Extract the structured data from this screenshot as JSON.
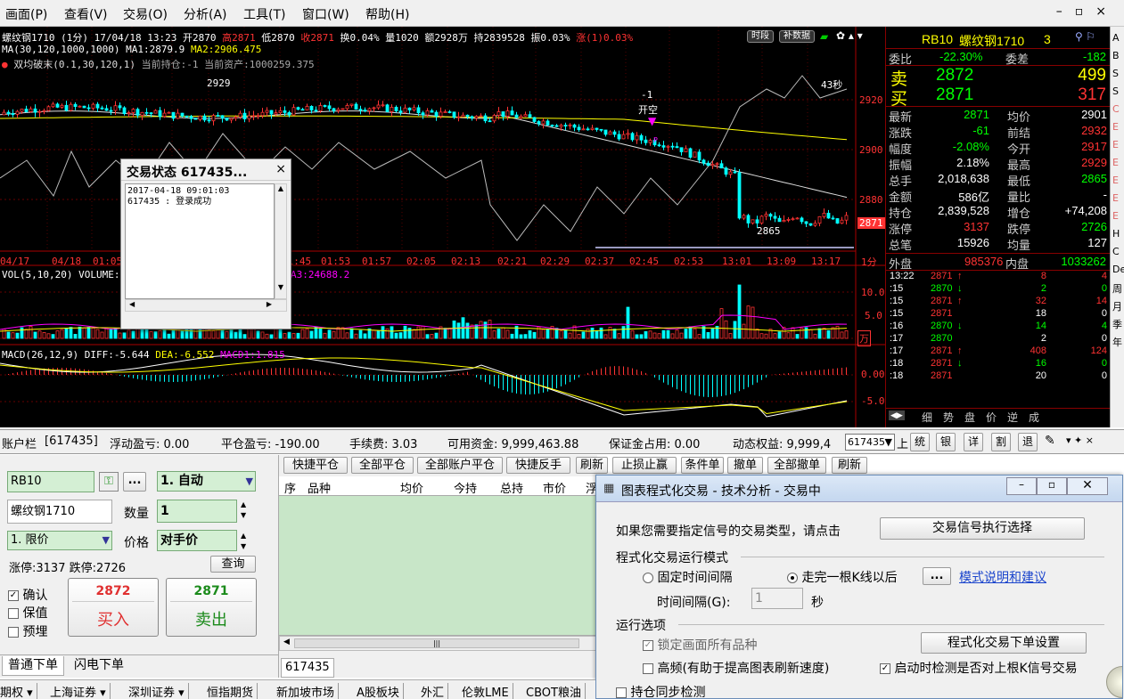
{
  "menu": {
    "items": [
      "画面(P)",
      "查看(V)",
      "交易(O)",
      "分析(A)",
      "工具(T)",
      "窗口(W)",
      "帮助(H)"
    ]
  },
  "chart_header": {
    "line1_instrument": "螺纹钢1710 (1分) 17/04/18 13:23",
    "open": "开2870",
    "high": "高2871",
    "low": "低2870",
    "close": "收2871",
    "turnover": "换0.04%",
    "volume": "量1020",
    "amount": "额2928万",
    "position": "持2839528",
    "amplitude": "振0.03%",
    "change": "涨(1)0.03%",
    "ma_line": "MA(30,120,1000,1000)",
    "ma1": "MA1:2879.9",
    "ma2": "MA2:2906.475",
    "strategy": "双均破末(0.1,30,120,1)",
    "holding": "当前持仓:-1",
    "assets": "当前资产:1000259.375",
    "btn_time": "时段",
    "btn_fill": "补数据"
  },
  "chart_labels": {
    "high_label": "2929",
    "low_label": "2865",
    "signal_num": "-1",
    "signal_text": "开空",
    "timer": "43秒",
    "cur_price": "2871",
    "y_ticks": [
      "2920",
      "2900",
      "2880"
    ],
    "x_ticks": [
      "04/17",
      "04/18",
      "01:05",
      "01:13",
      "01:21",
      "01:29",
      "01:37",
      "01:45",
      "01:53",
      "01:57",
      "02:05",
      "02:13",
      "02:21",
      "02:29",
      "02:37",
      "02:45",
      "02:53",
      "13:01",
      "13:09",
      "13:17"
    ],
    "period": "1分",
    "vol_title": "VOL(5,10,20) VOLUME:1",
    "vol_ma3": "A3:24688.2",
    "vol_ticks": [
      "10.0",
      "5.0"
    ],
    "vol_unit": "万",
    "macd_title": "MACD(26,12,9)",
    "diff": "DIFF:-5.644",
    "dea": "DEA:-6.552",
    "macd": "MACD1:1.815",
    "macd_ticks": [
      "0.00",
      "-5.00"
    ]
  },
  "popup": {
    "title": "交易状态 617435...",
    "time": "2017-04-18 09:01:03",
    "msg": "617435 : 登录成功"
  },
  "quote": {
    "code": "RB10",
    "name": "螺纹钢1710",
    "num": "3",
    "weibi_label": "委比",
    "weibi": "-22.30%",
    "weicha_label": "委差",
    "weicha": "-182",
    "sell_label": "卖",
    "sell_price": "2872",
    "sell_vol": "499",
    "buy_label": "买",
    "buy_price": "2871",
    "buy_vol": "317",
    "rows": [
      [
        "最新",
        "2871",
        "均价",
        "2901"
      ],
      [
        "涨跌",
        "-61",
        "前结",
        "2932"
      ],
      [
        "幅度",
        "-2.08%",
        "今开",
        "2917"
      ],
      [
        "振幅",
        "2.18%",
        "最高",
        "2929"
      ],
      [
        "总手",
        "2,018,638",
        "最低",
        "2865"
      ],
      [
        "金额",
        "586亿",
        "量比",
        "-"
      ],
      [
        "持仓",
        "2,839,528",
        "增仓",
        "+74,208"
      ],
      [
        "涨停",
        "3137",
        "跌停",
        "2726"
      ],
      [
        "总笔",
        "15926",
        "均量",
        "127"
      ]
    ],
    "outer_label": "外盘",
    "outer": "985376",
    "inner_label": "内盘",
    "inner": "1033262",
    "ticks": [
      [
        "13:22",
        "2871",
        "↑",
        "8",
        "4"
      ],
      [
        ":15",
        "2870",
        "↓",
        "2",
        "0"
      ],
      [
        ":15",
        "2871",
        "↑",
        "32",
        "14"
      ],
      [
        ":15",
        "2871",
        "",
        "18",
        "0"
      ],
      [
        ":16",
        "2870",
        "↓",
        "14",
        "4"
      ],
      [
        ":17",
        "2870",
        "",
        "2",
        "0"
      ],
      [
        ":17",
        "2871",
        "↑",
        "408",
        "124"
      ],
      [
        ":18",
        "2871",
        "↓",
        "16",
        "0"
      ],
      [
        ":18",
        "2871",
        "",
        "20",
        "0"
      ]
    ],
    "tabs": [
      "细",
      "势",
      "盘",
      "价",
      "逆",
      "成"
    ]
  },
  "farright": [
    "A",
    "B",
    "S",
    "S",
    "C",
    "E",
    "E",
    "E",
    "E",
    "E",
    "E",
    "H",
    "C",
    "De",
    "周",
    "月",
    "季",
    "年"
  ],
  "account": {
    "label": "账户栏",
    "id": "[617435]",
    "float_pl": "浮动盈亏: 0.00",
    "close_pl": "平仓盈亏: -190.00",
    "fee": "手续费: 3.03",
    "avail": "可用资金: 9,999,463.88",
    "margin": "保证金占用: 0.00",
    "equity": "动态权益: 9,999,4",
    "sel": "617435",
    "b1": "上",
    "b2": "统",
    "b3": "银",
    "b4": "详",
    "b5": "割",
    "b6": "退"
  },
  "order": {
    "code": "RB10",
    "mode": "1. 自动",
    "name": "螺纹钢1710",
    "qty_label": "数量",
    "qty": "1",
    "ptype": "1. 限价",
    "price_label": "价格",
    "price": "对手价",
    "limits": "涨停:3137 跌停:2726",
    "query": "查询",
    "chk_confirm": "确认",
    "chk_keep": "保值",
    "chk_pre": "预埋",
    "buy_price": "2872",
    "buy_label": "买入",
    "sell_price": "2871",
    "sell_label": "卖出",
    "tab1": "普通下单",
    "tab2": "闪电下单"
  },
  "positions": {
    "buttons": [
      "快捷平仓",
      "全部平仓",
      "全部账户平仓",
      "快捷反手",
      "刷新",
      "止损止赢",
      "条件单",
      "撤单",
      "全部撤单",
      "刷新"
    ],
    "cols": [
      "序",
      "品种",
      "均价",
      "今持",
      "总持",
      "市价",
      "浮"
    ],
    "account": "617435"
  },
  "dialog": {
    "title": "图表程式化交易 - 技术分析 - 交易中",
    "hint": "如果您需要指定信号的交易类型，请点击",
    "signal_btn": "交易信号执行选择",
    "mode_title": "程式化交易运行模式",
    "mode_fixed": "固定时间间隔",
    "mode_bar": "走完一根K线以后",
    "more": "...",
    "mode_link": "模式说明和建议",
    "interval_label": "时间间隔(G):",
    "interval": "1",
    "sec": "秒",
    "opt_title": "运行选项",
    "lock": "锁定画面所有品种",
    "order_btn": "程式化交易下单设置",
    "highfreq": "高频(有助于提高图表刷新速度)",
    "detect": "启动时检测是否对上根K信号交易",
    "sync": "持仓同步检测"
  },
  "bottom_tabs": [
    "期权",
    "上海证券",
    "深圳证券",
    "恒指期货",
    "新加坡市场",
    "A股板块",
    "外汇",
    "伦敦LME",
    "CBOT粮油"
  ],
  "colors": {
    "up": "#ff3333",
    "down": "#00ffff",
    "yellow": "#ffff00",
    "white": "#ffffff",
    "magenta": "#ff00ff",
    "green": "#00e000",
    "accent_red": "#e03030"
  }
}
